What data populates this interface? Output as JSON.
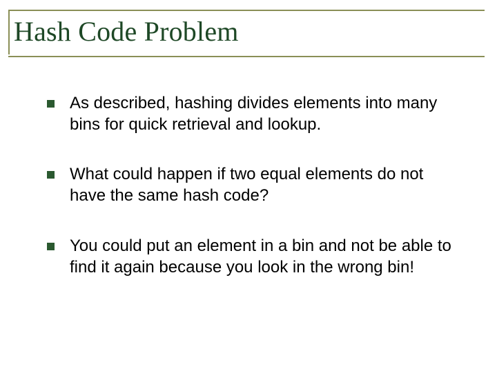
{
  "title": "Hash Code Problem",
  "bullets": [
    "As described, hashing divides elements into many bins for quick retrieval and lookup.",
    "What could happen if two equal elements do not have the same hash code?",
    "You could put an element in a bin and not be able to find it again because you look in the wrong bin!"
  ],
  "colors": {
    "title": "#1e4826",
    "rule": "#8a8f56",
    "bullet": "#2b5930"
  }
}
